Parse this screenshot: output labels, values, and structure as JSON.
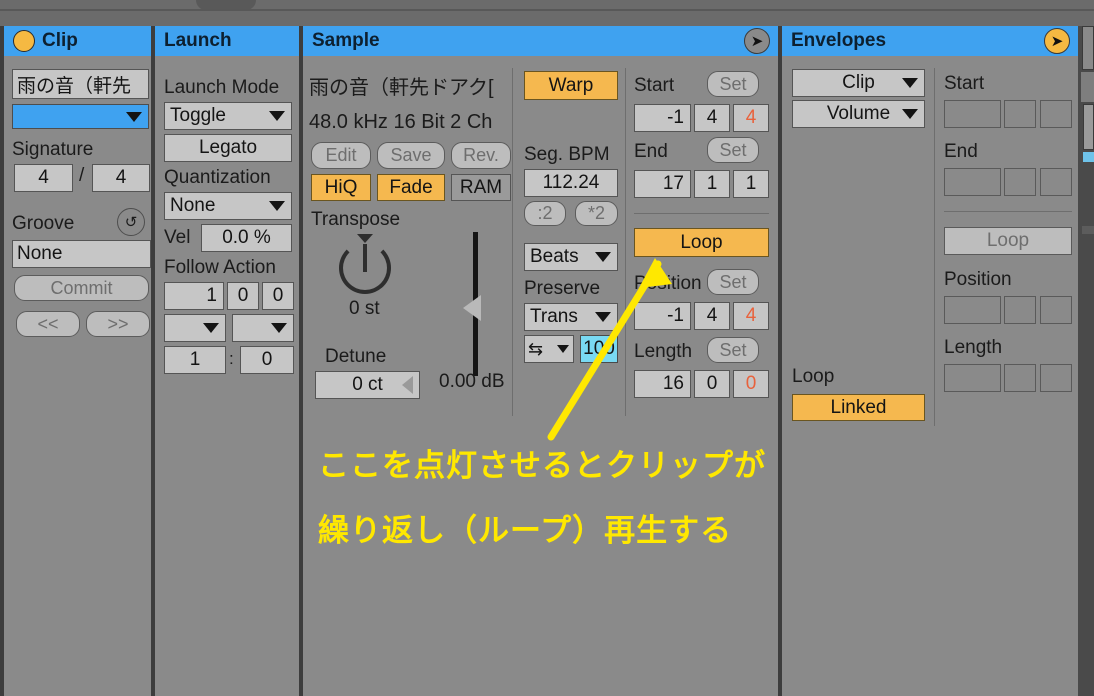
{
  "app": {
    "name": "Ableton Live Clip View"
  },
  "panels": {
    "clip": {
      "title": "Clip",
      "dot_icon": "clip-color-dot",
      "name_field": {
        "value": "雨の音（軒先"
      },
      "color_swatch": {
        "value": "",
        "color": "#3fa2f0"
      },
      "signature_label": "Signature",
      "signature_numerator": "4",
      "signature_slash": "/",
      "signature_denominator": "4",
      "groove_label": "Groove",
      "groove_refresh_icon": "refresh-icon",
      "groove_value": "None",
      "commit_label": "Commit",
      "prev_label": "<<",
      "next_label": ">>"
    },
    "launch": {
      "title": "Launch",
      "launch_mode_label": "Launch Mode",
      "launch_mode_value": "Toggle",
      "legato_label": "Legato",
      "quantization_label": "Quantization",
      "quantization_value": "None",
      "vel_label": "Vel",
      "vel_value": "0.0 %",
      "follow_action_label": "Follow Action",
      "follow_bars": "1",
      "follow_beats": "0",
      "follow_sixteenths": "0",
      "action_a": "",
      "action_b": "",
      "chance_a": "1",
      "chance_colon": ":",
      "chance_b": "0"
    },
    "sample": {
      "title": "Sample",
      "header_arrow_icon": "arrow-right-circle-icon",
      "file_name": "雨の音（軒先ドアク[",
      "file_specs": "48.0 kHz 16 Bit 2 Ch",
      "edit_label": "Edit",
      "save_label": "Save",
      "rev_label": "Rev.",
      "hiq_label": "HiQ",
      "fade_label": "Fade",
      "ram_label": "RAM",
      "transpose_label": "Transpose",
      "transpose_value": "0 st",
      "detune_label": "Detune",
      "detune_value": "0 ct",
      "gain_value": "0.00 dB",
      "warp_label": "Warp",
      "seg_bpm_label": "Seg. BPM",
      "seg_bpm_value": "112.24",
      "halve_label": ":2",
      "double_label": "*2",
      "warp_mode_value": "Beats",
      "preserve_label": "Preserve",
      "preserve_value": "Trans",
      "transient_loop_icon": "transient-loop-icon",
      "transient_envelope_value": "100",
      "start_label": "Start",
      "start_set_label": "Set",
      "start_bars": "-1",
      "start_beats": "4",
      "start_sixteenths": "4",
      "end_label": "End",
      "end_set_label": "Set",
      "end_bars": "17",
      "end_beats": "1",
      "end_sixteenths": "1",
      "loop_label": "Loop",
      "position_label": "Position",
      "position_set_label": "Set",
      "position_bars": "-1",
      "position_beats": "4",
      "position_sixteenths": "4",
      "length_label": "Length",
      "length_set_label": "Set",
      "length_bars": "16",
      "length_beats": "0",
      "length_sixteenths": "0"
    },
    "envelopes": {
      "title": "Envelopes",
      "header_arrow_icon": "arrow-right-circle-icon",
      "device_value": "Clip",
      "parameter_value": "Volume",
      "loop_label": "Loop",
      "linked_label": "Linked",
      "start_label": "Start",
      "start_bars": "",
      "start_beats": "",
      "start_sixteenths": "",
      "end_label": "End",
      "end_bars": "",
      "end_beats": "",
      "end_sixteenths": "",
      "env_loop_label": "Loop",
      "position_label": "Position",
      "position_bars": "",
      "position_beats": "",
      "position_sixteenths": "",
      "length_label": "Length",
      "length_bars": "",
      "length_beats": "",
      "length_sixteenths": ""
    }
  },
  "annotation": {
    "line1": "ここを点灯させるとクリップが",
    "line2": "繰り返し（ループ）再生する",
    "arrow_icon": "pointer-arrow-icon",
    "color": "#ffe800"
  },
  "colors": {
    "accent_blue": "#3fa2f0",
    "active_orange": "#f5b84f",
    "panel_bg": "#8a8a8a",
    "frame": "#3d3d3d",
    "selected_cyan": "#79d9f2",
    "red_value": "#e8623c"
  }
}
